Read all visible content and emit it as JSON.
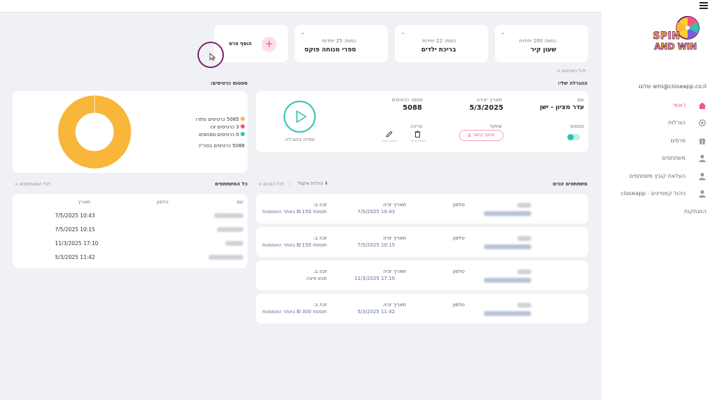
{
  "brand": {
    "line1": "SPIN",
    "line2": "AND WIN"
  },
  "user": {
    "greeting": "שלום ami@closeapp.co.il"
  },
  "nav": {
    "items": [
      {
        "label": "ראשי",
        "icon": "home-icon",
        "active": true
      },
      {
        "label": "הגרלות",
        "icon": "gear-icon"
      },
      {
        "label": "פרסים",
        "icon": "gift-icon"
      },
      {
        "label": "משתתפים",
        "icon": "user-icon"
      },
      {
        "label": "העלאת קובץ משתתפים",
        "icon": "user-upload-icon"
      },
      {
        "label": "ניהול קמפיינים - closeapp",
        "icon": "user-manage-icon"
      }
    ],
    "logout": "התנתקות"
  },
  "prizes": {
    "cards": [
      {
        "qty": "כמות: 200 יחידות",
        "name": "שעון קיר"
      },
      {
        "qty": "כמות: 22 יחידות",
        "name": "בריכת ילדים"
      },
      {
        "qty": "כמות: 25 יחידות",
        "name": "ספרי מנוחה פוקס"
      }
    ],
    "add_label": "הוסף פרס",
    "all_link": "לכל הפרסים >"
  },
  "my_lottery": {
    "section_title": "ההגרלה שלי:",
    "name_label": "שם",
    "name": "עדר מציון - ישן",
    "date_label": "תאריך יצירה",
    "date": "5/3/2025",
    "cards_label": "מספר כרטיסים",
    "cards": "5088",
    "status_label": "סטטוס",
    "share_label": "שיתוף",
    "share_button": "שיתוף קישור",
    "edit_label": "עריכה",
    "edit_caption": "עריכת הגרלה",
    "delete_caption": "מחיקת הגרלה",
    "watch_label": "צפייה בהגרלה"
  },
  "cards_status": {
    "title": "סטטוס כרטיסים:",
    "legend": [
      {
        "text": "5085 כרטיסים נותרו",
        "color": "#f8b63a"
      },
      {
        "text": "3 כרטיסים זכו",
        "color": "#f4587a"
      },
      {
        "text": "0 כרטיסים מפספים",
        "color": "#2cc4b0"
      }
    ],
    "total": "5088 כרטיסים בסה\"כ",
    "chart": {
      "remaining": 5085,
      "won": 3,
      "missed": 0
    }
  },
  "winners": {
    "title": "משתתפים זוכים",
    "export_label": "הורדת אקסל",
    "all_link": "לכל הזוכים >",
    "phone_label": "טלפון",
    "date_label": "תאריך זכיה",
    "prize_label": "זכה ב:",
    "rows": [
      {
        "date": "7/5/2025 10:43",
        "prize": "תוספת 150 ₪ באתר האמפנות"
      },
      {
        "date": "7/5/2025 10:15",
        "prize": "תוספת 150 ₪ באתר האמפנות"
      },
      {
        "date": "11/3/2025 17:10",
        "prize": "מגש פיצה"
      },
      {
        "date": "5/3/2025 11:42",
        "prize": "תוספת 300 ₪ באתר האמפנות"
      }
    ]
  },
  "participants": {
    "title": "כל המשתתפים",
    "all_link": "לכל המשתתפים >",
    "headers": {
      "name": "שם",
      "phone": "טלפון",
      "date": "תאריך"
    },
    "rows": [
      {
        "date": "7/5/2025 10:43"
      },
      {
        "date": "7/5/2025 10:15"
      },
      {
        "date": "11/3/2025 17:10"
      },
      {
        "date": "5/3/2025 11:42"
      }
    ]
  },
  "colors": {
    "accent_teal": "#2cc4b0",
    "accent_pink": "#f4587a",
    "donut": "#f8b63a",
    "focus_ring": "#7b1e6e"
  }
}
